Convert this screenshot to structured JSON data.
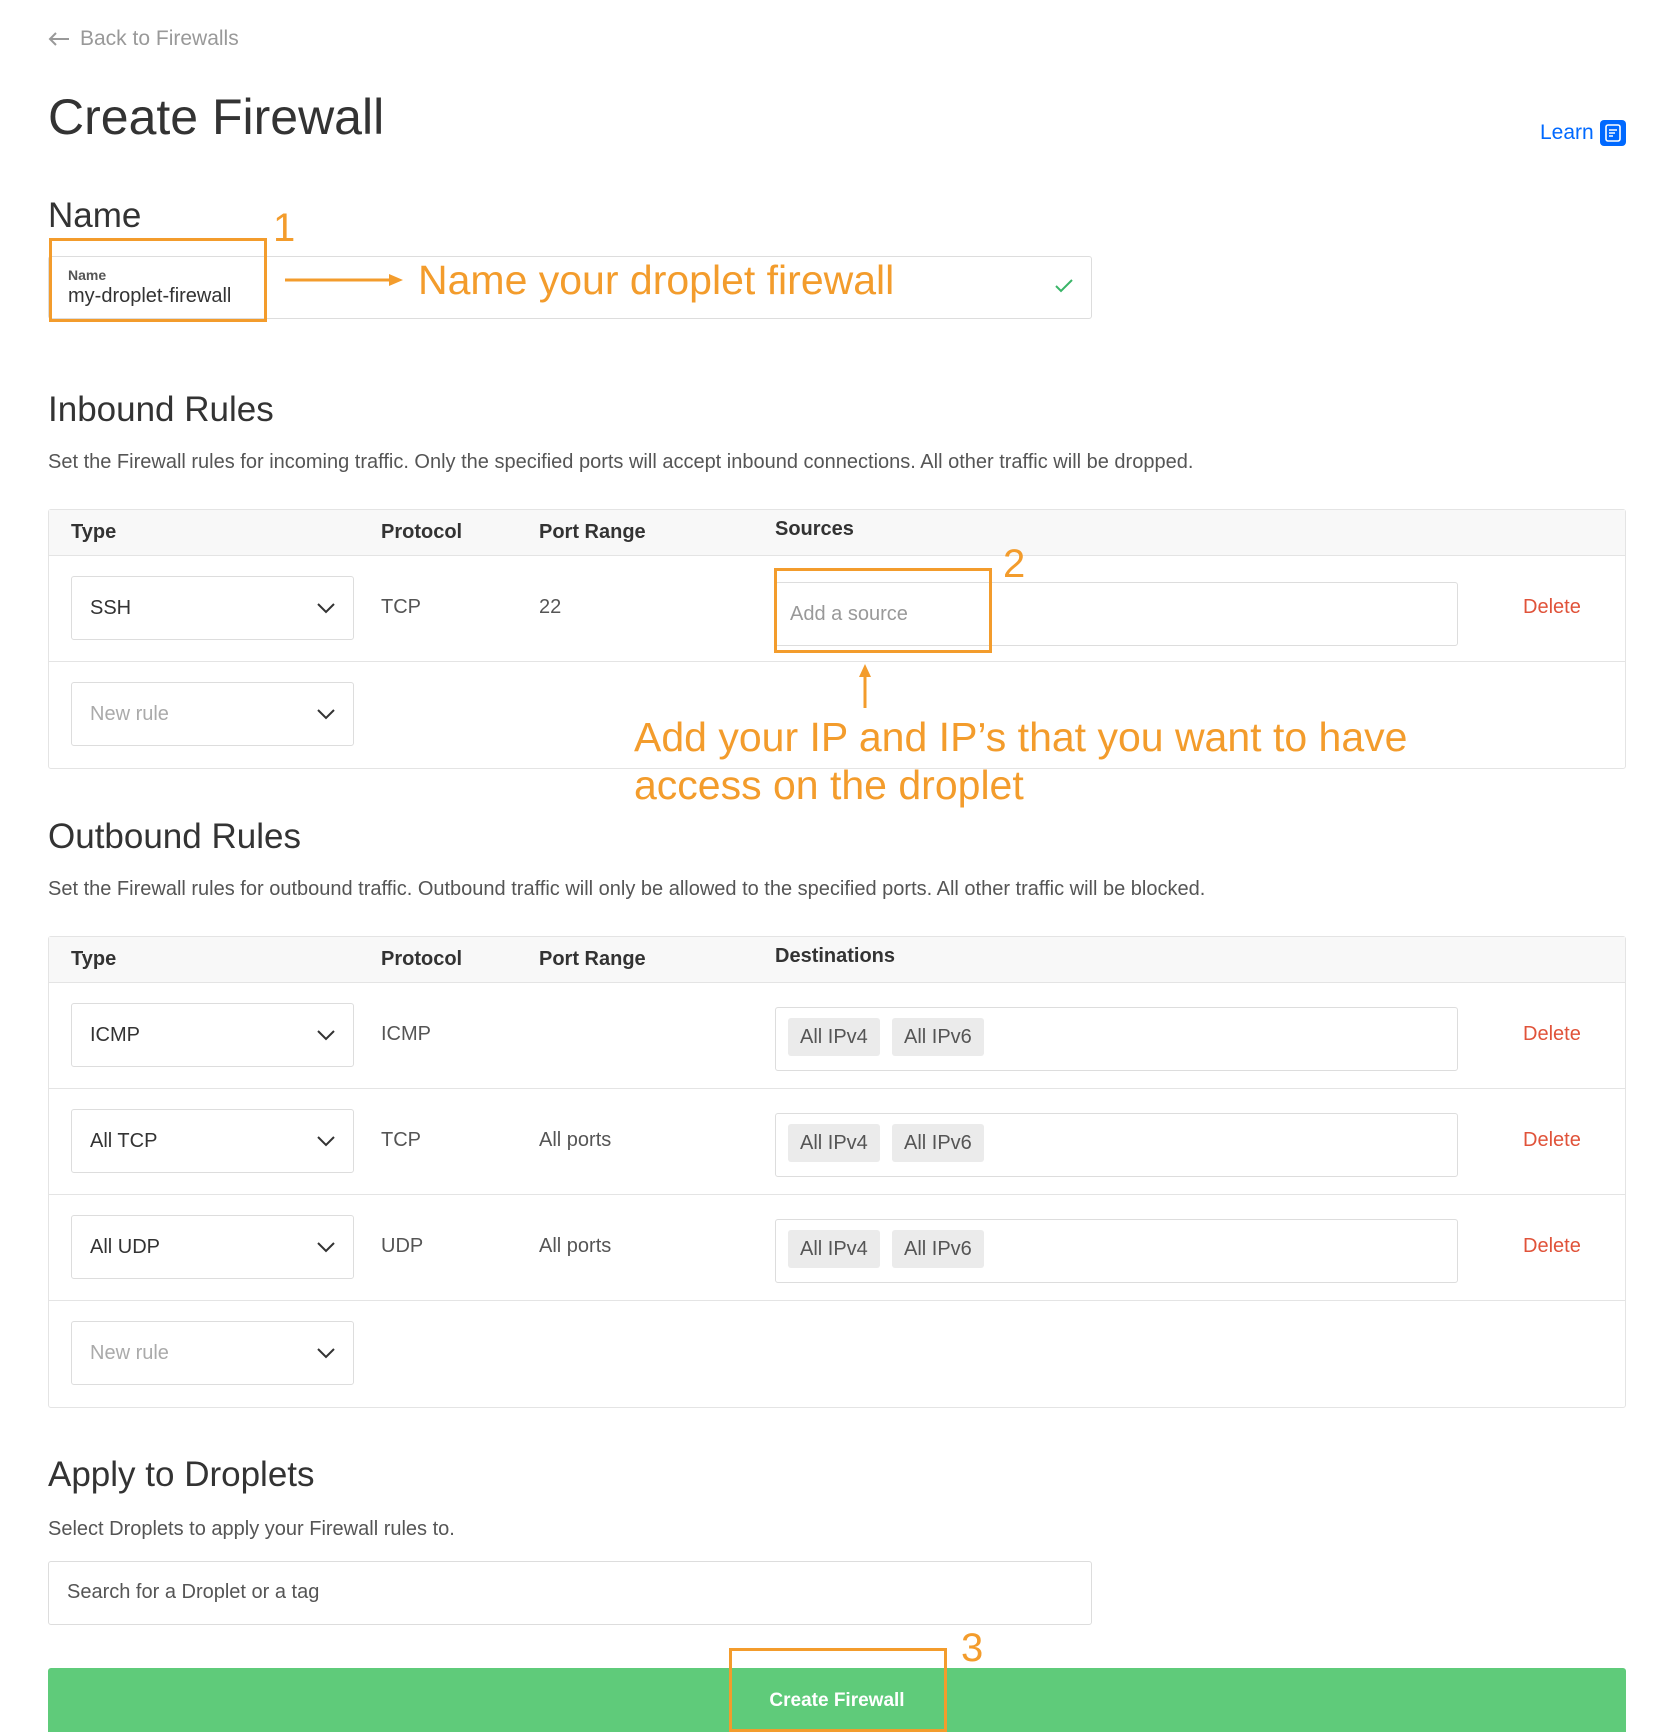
{
  "nav": {
    "back_label": "Back to Firewalls"
  },
  "header": {
    "title": "Create Firewall",
    "learn_label": "Learn"
  },
  "name_section": {
    "heading": "Name",
    "field_label": "Name",
    "field_value": "my-droplet-firewall"
  },
  "inbound": {
    "heading": "Inbound Rules",
    "description": "Set the Firewall rules for incoming traffic. Only the specified ports will accept inbound connections. All other traffic will be dropped.",
    "columns": [
      "Type",
      "Protocol",
      "Port Range",
      "Sources"
    ],
    "rows": [
      {
        "type": "SSH",
        "protocol": "TCP",
        "port_range": "22",
        "source_placeholder": "Add a source",
        "delete_label": "Delete"
      }
    ],
    "new_rule_placeholder": "New rule"
  },
  "outbound": {
    "heading": "Outbound Rules",
    "description": "Set the Firewall rules for outbound traffic. Outbound traffic will only be allowed to the specified ports. All other traffic will be blocked.",
    "columns": [
      "Type",
      "Protocol",
      "Port Range",
      "Destinations"
    ],
    "rows": [
      {
        "type": "ICMP",
        "protocol": "ICMP",
        "port_range": "",
        "tags": [
          "All IPv4",
          "All IPv6"
        ],
        "delete_label": "Delete"
      },
      {
        "type": "All TCP",
        "protocol": "TCP",
        "port_range": "All ports",
        "tags": [
          "All IPv4",
          "All IPv6"
        ],
        "delete_label": "Delete"
      },
      {
        "type": "All UDP",
        "protocol": "UDP",
        "port_range": "All ports",
        "tags": [
          "All IPv4",
          "All IPv6"
        ],
        "delete_label": "Delete"
      }
    ],
    "new_rule_placeholder": "New rule"
  },
  "apply": {
    "heading": "Apply to Droplets",
    "description": "Select Droplets to apply your Firewall rules to.",
    "search_placeholder": "Search for a Droplet or a tag"
  },
  "submit": {
    "label": "Create Firewall"
  },
  "annotations": {
    "num1": "1",
    "text1": "Name your droplet firewall",
    "num2": "2",
    "text2_line1": "Add your IP and IP’s that you want to have",
    "text2_line2": "access on the droplet",
    "num3": "3"
  },
  "colors": {
    "accent_blue": "#0069ff",
    "delete_red": "#e0533a",
    "create_green": "#5fcb7a",
    "annotation_orange": "#f39c2c",
    "check_green": "#3ab568"
  }
}
